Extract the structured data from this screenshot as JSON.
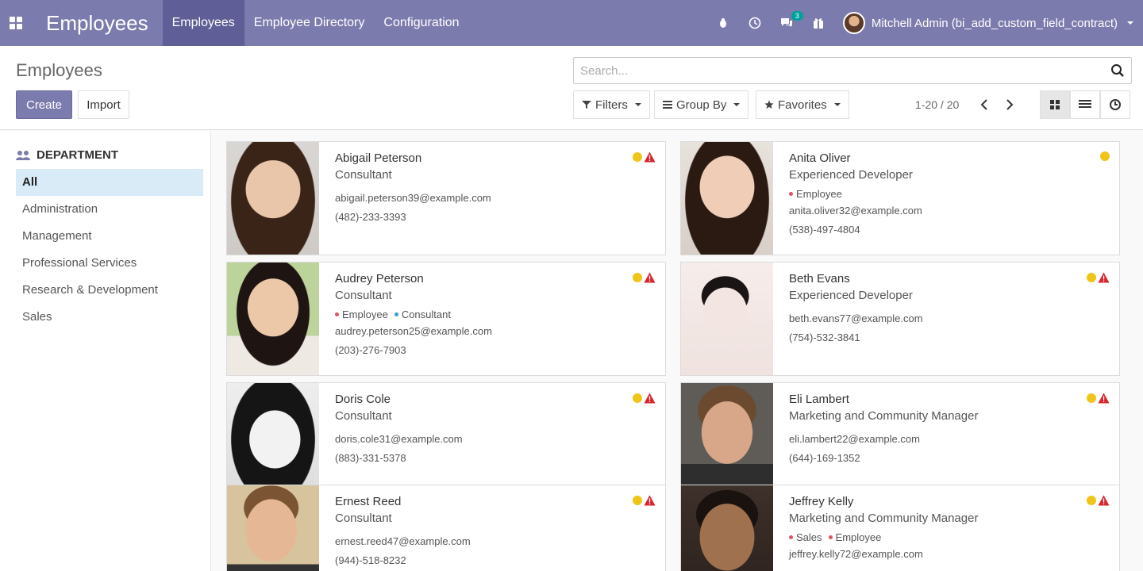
{
  "topbar": {
    "app_title": "Employees",
    "menu": [
      {
        "label": "Employees",
        "active": true
      },
      {
        "label": "Employee Directory",
        "active": false
      },
      {
        "label": "Configuration",
        "active": false
      }
    ],
    "chat_badge": "3",
    "user_name": "Mitchell Admin (bi_add_custom_field_contract)",
    "accent": "#7c7bad"
  },
  "cpanel": {
    "breadcrumb": "Employees",
    "create_label": "Create",
    "import_label": "Import",
    "search_placeholder": "Search...",
    "filters_label": "Filters",
    "groupby_label": "Group By",
    "favorites_label": "Favorites",
    "pager": "1-20 / 20"
  },
  "sidebar": {
    "title": "DEPARTMENT",
    "items": [
      {
        "label": "All",
        "active": true
      },
      {
        "label": "Administration",
        "active": false
      },
      {
        "label": "Management",
        "active": false
      },
      {
        "label": "Professional Services",
        "active": false
      },
      {
        "label": "Research & Development",
        "active": false
      },
      {
        "label": "Sales",
        "active": false
      }
    ]
  },
  "employees": [
    {
      "name": "Abigail Peterson",
      "job": "Consultant",
      "tags": [],
      "email": "abigail.peterson39@example.com",
      "phone": "(482)-233-3393",
      "warning": true
    },
    {
      "name": "Anita Oliver",
      "job": "Experienced Developer",
      "tags": [
        {
          "label": "Employee",
          "color": "#e0545f"
        }
      ],
      "email": "anita.oliver32@example.com",
      "phone": "(538)-497-4804",
      "warning": false
    },
    {
      "name": "Audrey Peterson",
      "job": "Consultant",
      "tags": [
        {
          "label": "Employee",
          "color": "#e0545f"
        },
        {
          "label": "Consultant",
          "color": "#3d9ad6"
        }
      ],
      "email": "audrey.peterson25@example.com",
      "phone": "(203)-276-7903",
      "warning": true
    },
    {
      "name": "Beth Evans",
      "job": "Experienced Developer",
      "tags": [],
      "email": "beth.evans77@example.com",
      "phone": "(754)-532-3841",
      "warning": true
    },
    {
      "name": "Doris Cole",
      "job": "Consultant",
      "tags": [],
      "email": "doris.cole31@example.com",
      "phone": "(883)-331-5378",
      "warning": true
    },
    {
      "name": "Eli Lambert",
      "job": "Marketing and Community Manager",
      "tags": [],
      "email": "eli.lambert22@example.com",
      "phone": "(644)-169-1352",
      "warning": true
    },
    {
      "name": "Ernest Reed",
      "job": "Consultant",
      "tags": [],
      "email": "ernest.reed47@example.com",
      "phone": "(944)-518-8232",
      "warning": true
    },
    {
      "name": "Jeffrey Kelly",
      "job": "Marketing and Community Manager",
      "tags": [
        {
          "label": "Sales",
          "color": "#e0545f"
        },
        {
          "label": "Employee",
          "color": "#e0545f"
        }
      ],
      "email": "jeffrey.kelly72@example.com",
      "phone": "",
      "warning": true
    }
  ]
}
